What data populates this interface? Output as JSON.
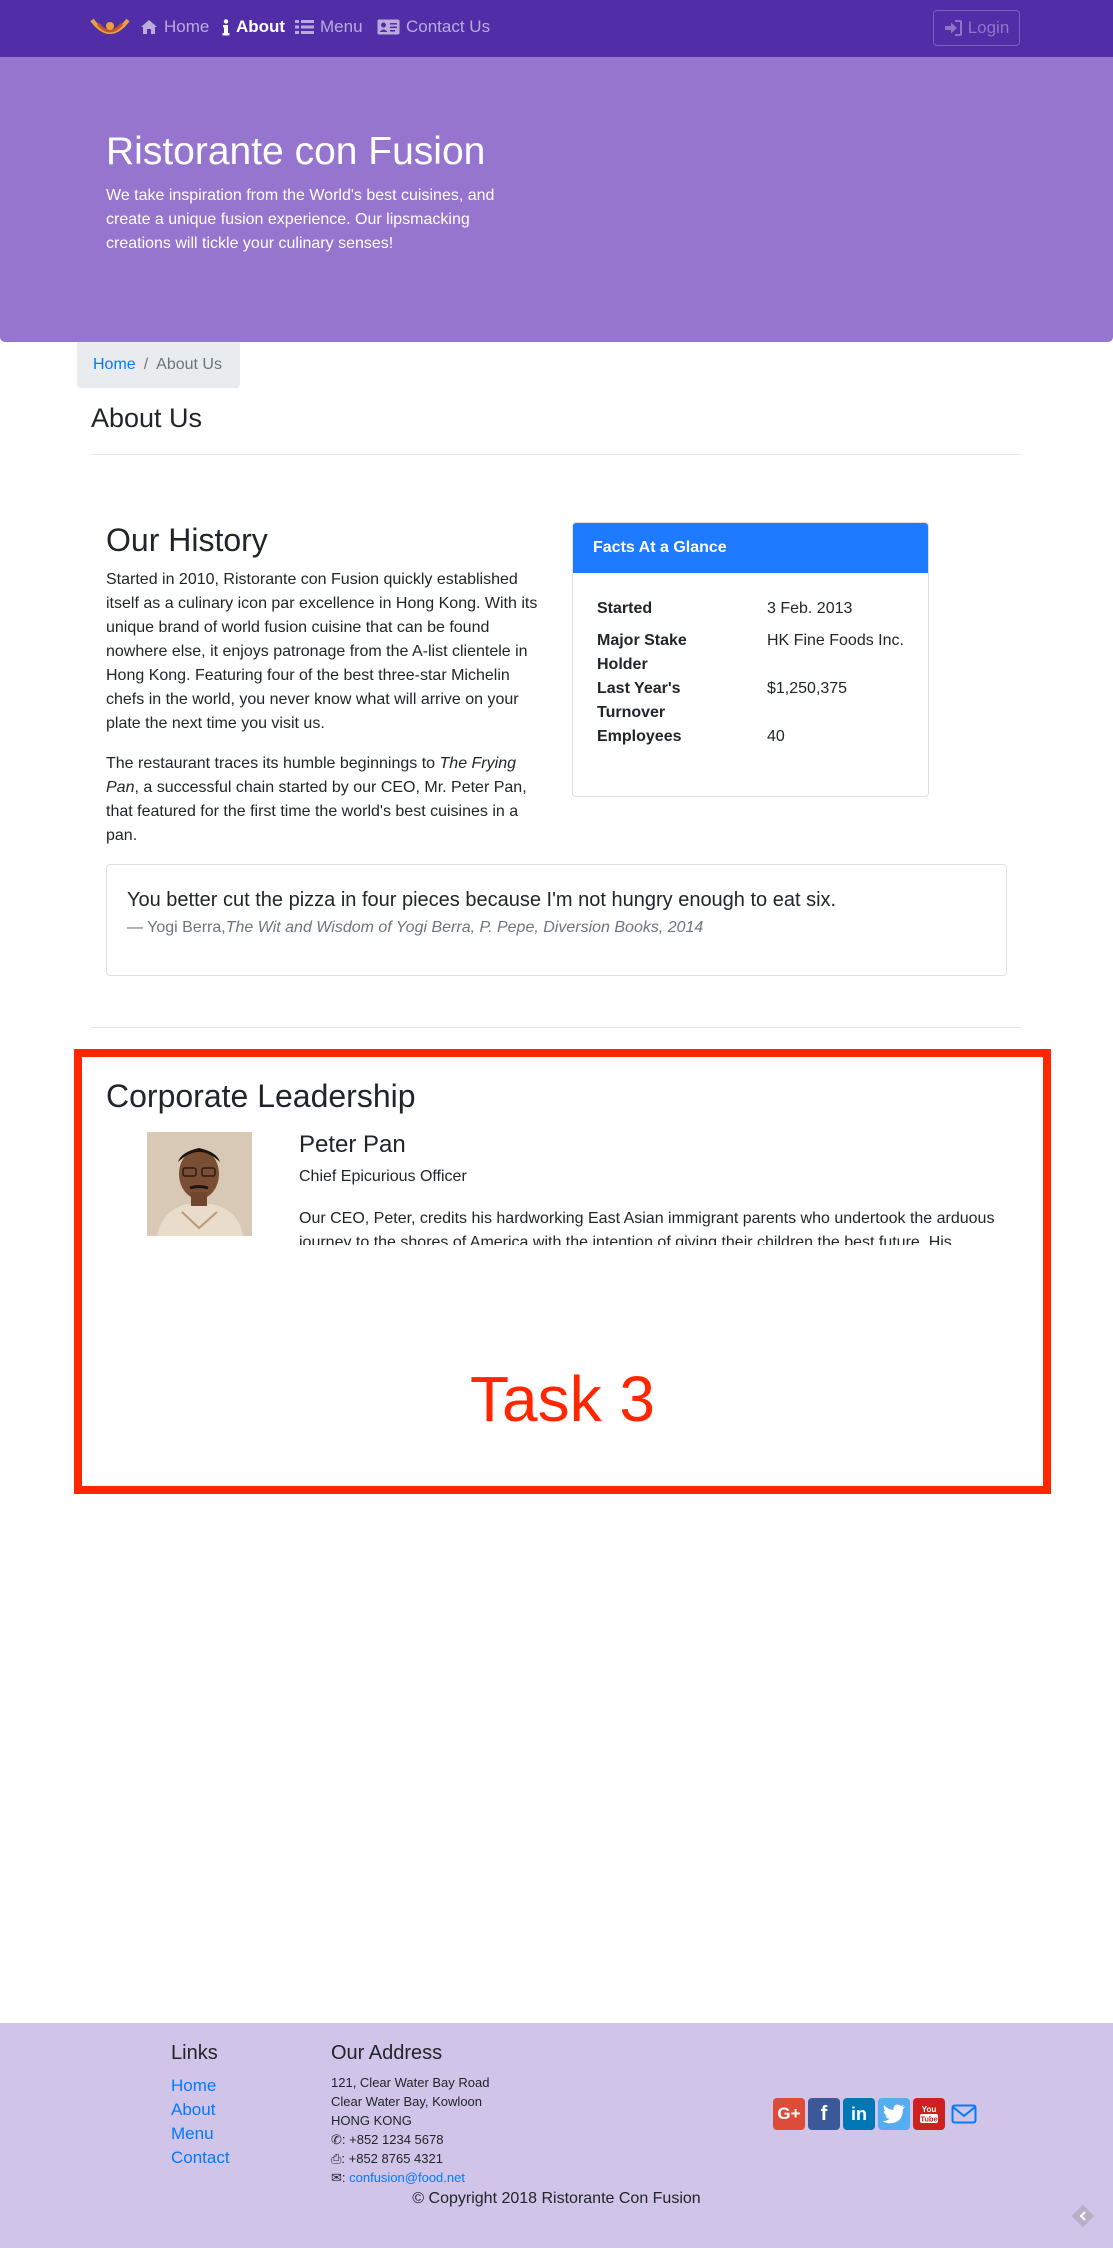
{
  "nav": {
    "items": [
      {
        "label": "Home",
        "icon": "home-icon"
      },
      {
        "label": "About",
        "icon": "info-icon"
      },
      {
        "label": "Menu",
        "icon": "list-icon"
      },
      {
        "label": "Contact Us",
        "icon": "address-card-icon"
      }
    ],
    "login": "Login"
  },
  "jumbotron": {
    "title": "Ristorante con Fusion",
    "text": "We take inspiration from the World's best cuisines, and create a unique fusion experience. Our lipsmacking creations will tickle your culinary senses!"
  },
  "breadcrumb": {
    "home": "Home",
    "separator": "/",
    "current": "About Us"
  },
  "page_title": "About Us",
  "history": {
    "heading": "Our History",
    "p1": "Started in 2010, Ristorante con Fusion quickly established itself as a culinary icon par excellence in Hong Kong. With its unique brand of world fusion cuisine that can be found nowhere else, it enjoys patronage from the A-list clientele in Hong Kong. Featuring four of the best three-star Michelin chefs in the world, you never know what will arrive on your plate the next time you visit us.",
    "p2_before": "The restaurant traces its humble beginnings to ",
    "p2_em": "The Frying Pan",
    "p2_after": ", a successful chain started by our CEO, Mr. Peter Pan, that featured for the first time the world's best cuisines in a pan."
  },
  "facts": {
    "header": "Facts At a Glance",
    "rows": [
      {
        "term": "Started",
        "value": "3 Feb. 2013"
      },
      {
        "term": "Major Stake Holder",
        "value": "HK Fine Foods Inc."
      },
      {
        "term": "Last Year's Turnover",
        "value": "$1,250,375"
      },
      {
        "term": "Employees",
        "value": "40"
      }
    ]
  },
  "quote": {
    "text": "You better cut the pizza in four pieces because I'm not hungry enough to eat six.",
    "dash": "— Yogi Berra,",
    "source": "The Wit and Wisdom of Yogi Berra, P. Pepe, Diversion Books, 2014"
  },
  "leadership": {
    "heading": "Corporate Leadership",
    "name": "Peter Pan",
    "role": "Chief Epicurious Officer",
    "bio": "Our CEO, Peter, credits his hardworking East Asian immigrant parents who undertook the arduous journey to the shores of America with the intention of giving their children the best future. His"
  },
  "task_label": "Task 3",
  "footer": {
    "links_heading": "Links",
    "links": [
      "Home",
      "About",
      "Menu",
      "Contact"
    ],
    "address_heading": "Our Address",
    "address": [
      "121, Clear Water Bay Road",
      "Clear Water Bay, Kowloon",
      "HONG KONG"
    ],
    "phone": ": +852 1234 5678",
    "fax": ": +852 8765 4321",
    "email": "confusion@food.net",
    "social": [
      "google-plus-icon",
      "facebook-icon",
      "linkedin-icon",
      "twitter-icon",
      "youtube-icon",
      "envelope-icon"
    ],
    "copyright": "© Copyright 2018 Ristorante Con Fusion"
  },
  "colors": {
    "navbar": "#512DA8",
    "jumbotron": "#9575CD",
    "footer": "#D1C4E9",
    "card_header": "#1E7BFF",
    "task_border": "#FF2600",
    "link": "#007bff"
  }
}
